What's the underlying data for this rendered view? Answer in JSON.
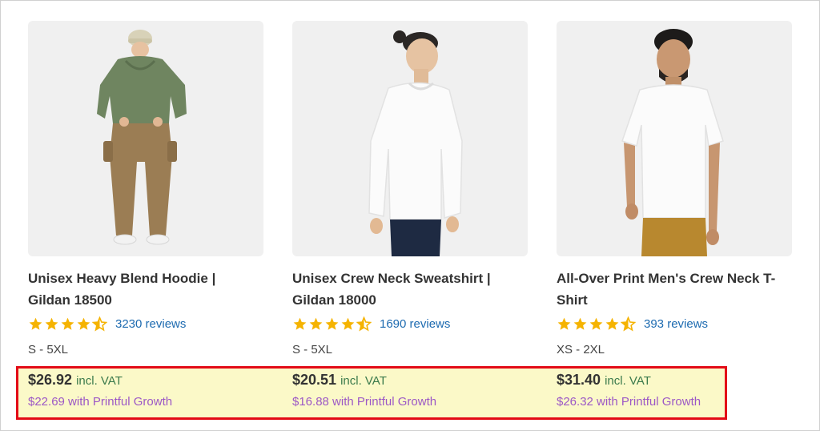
{
  "products": [
    {
      "title": "Unisex Heavy Blend Hoodie | Gildan 18500",
      "rating": 4.5,
      "reviews": "3230 reviews",
      "sizes": "S - 5XL",
      "price": "$26.92",
      "vat": "incl. VAT",
      "growth_price": "$22.69 with Printful Growth"
    },
    {
      "title": "Unisex Crew Neck Sweatshirt | Gildan 18000",
      "rating": 4.5,
      "reviews": "1690 reviews",
      "sizes": "S - 5XL",
      "price": "$20.51",
      "vat": "incl. VAT",
      "growth_price": "$16.88 with Printful Growth"
    },
    {
      "title": "All-Over Print Men's Crew Neck T-Shirt",
      "rating": 4.5,
      "reviews": "393 reviews",
      "sizes": "XS - 2XL",
      "price": "$31.40",
      "vat": "incl. VAT",
      "growth_price": "$26.32 with Printful Growth"
    }
  ],
  "colors": {
    "star": "#f5b301",
    "link": "#1c6ab0",
    "highlight_bg": "#fbf9c8",
    "highlight_border": "#e30b17",
    "growth": "#9c58c6"
  }
}
